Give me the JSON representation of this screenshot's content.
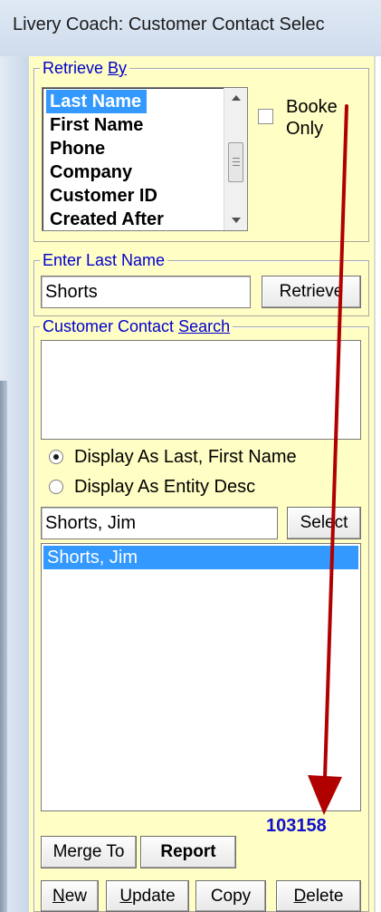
{
  "window": {
    "title": "Livery Coach: Customer Contact Selec"
  },
  "retrieve_by": {
    "legend_prefix": "Retrieve ",
    "legend_accel": "By",
    "options": [
      "Last Name",
      "First Name",
      "Phone",
      "Company",
      "Customer ID",
      "Created After"
    ],
    "selected": "Last Name",
    "booked_only_line1": "Booke",
    "booked_only_line2": "Only",
    "booked_only_checked": false
  },
  "enter_name": {
    "legend": "Enter Last Name",
    "value": "Shorts",
    "retrieve_button": "Retrieve"
  },
  "search": {
    "legend_prefix": "Customer Contact ",
    "legend_accel": "Search",
    "display_last_first": "Display As Last, First Name",
    "display_entity": "Display As Entity Desc",
    "selected_display": "Display As Last, First Name",
    "select_value": "Shorts, Jim",
    "select_button": "Select",
    "results": [
      "Shorts, Jim"
    ],
    "record_count": "103158"
  },
  "actions": {
    "merge_to": "Merge To",
    "report": "Report",
    "new_accel": "N",
    "new_rest": "ew",
    "update_accel": "U",
    "update_rest": "pdate",
    "copy": "Copy",
    "delete_accel": "D",
    "delete_rest": "elete"
  },
  "colors": {
    "panel": "#fffec4",
    "legend_text": "#0000cc",
    "selection": "#3399ff",
    "record_count": "#1010cc",
    "annotation_arrow": "#b00000"
  }
}
